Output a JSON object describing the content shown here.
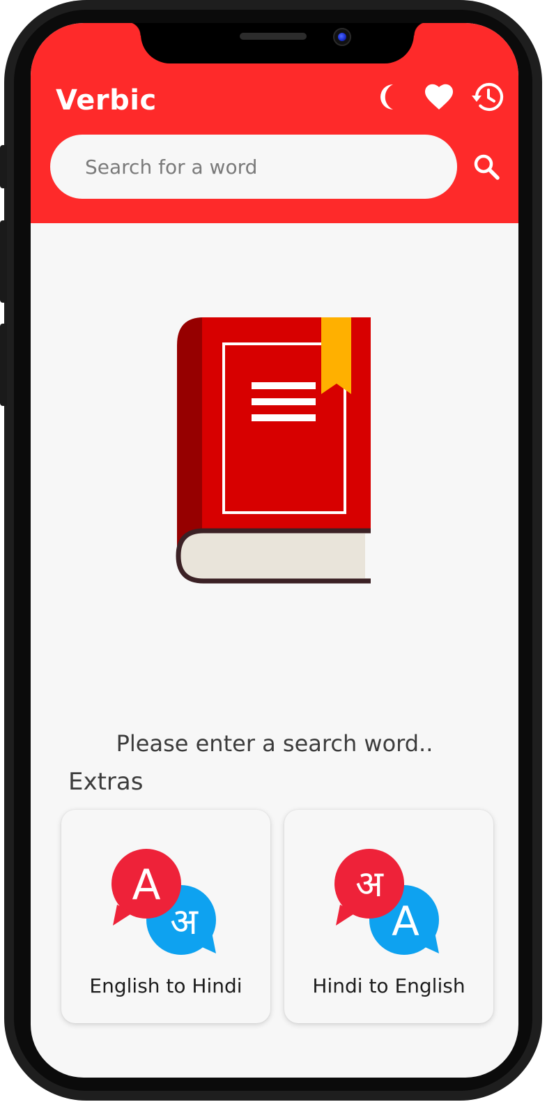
{
  "app": {
    "title": "Verbic"
  },
  "toolbar": {
    "dark_mode_icon": "moon-icon",
    "favorites_icon": "heart-icon",
    "history_icon": "history-icon"
  },
  "search": {
    "placeholder": "Search for a word",
    "value": "",
    "button_icon": "search-icon"
  },
  "empty_state": {
    "illustration": "book-icon",
    "message": "Please enter a search word.."
  },
  "extras": {
    "title": "Extras",
    "cards": [
      {
        "label": "English to Hindi",
        "icon": "english-to-hindi-icon",
        "front_glyph": "A",
        "back_glyph": "अ"
      },
      {
        "label": "Hindi to English",
        "icon": "hindi-to-english-icon",
        "front_glyph": "अ",
        "back_glyph": "A"
      }
    ]
  },
  "colors": {
    "primary": "#fe2a2a",
    "background": "#f7f7f7",
    "bubble_red": "#ee2239",
    "bubble_blue": "#0ea2f0",
    "book_red": "#d70000",
    "bookmark": "#ffb000"
  }
}
